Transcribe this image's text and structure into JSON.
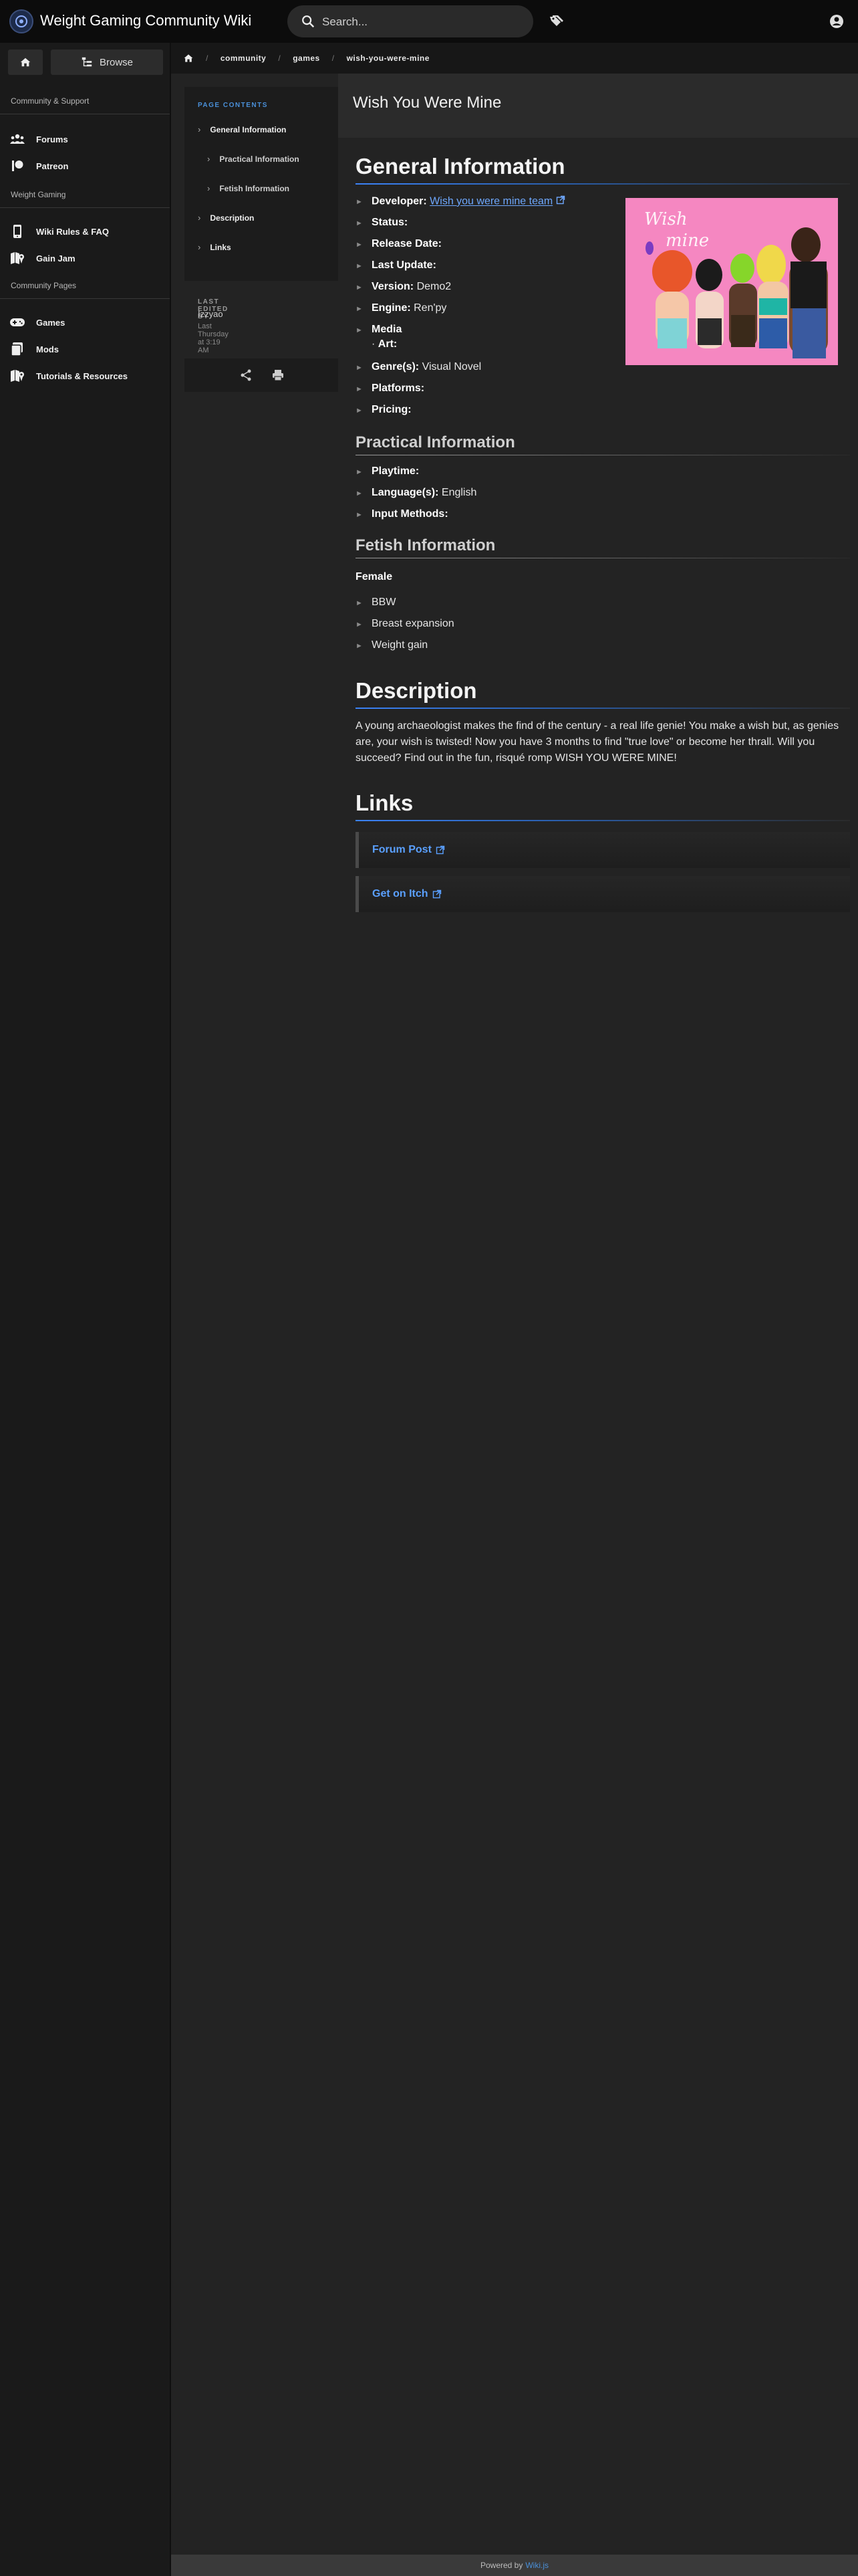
{
  "header": {
    "site_title": "Weight Gaming Community Wiki",
    "search_placeholder": "Search..."
  },
  "sidebar": {
    "browse_label": "Browse",
    "sections": [
      {
        "header": "Community & Support"
      },
      {
        "header": "Weight Gaming"
      },
      {
        "header": "Community Pages"
      }
    ],
    "items": [
      {
        "label": "Forums",
        "icon": "people-icon"
      },
      {
        "label": "Patreon",
        "icon": "patreon-icon"
      },
      {
        "label": "Wiki Rules & FAQ",
        "icon": "phone-rules-icon"
      },
      {
        "label": "Gain Jam",
        "icon": "map-icon"
      },
      {
        "label": "Games",
        "icon": "gamepad-icon"
      },
      {
        "label": "Mods",
        "icon": "cards-icon"
      },
      {
        "label": "Tutorials & Resources",
        "icon": "map-icon"
      }
    ]
  },
  "breadcrumb": [
    "community",
    "games",
    "wish-you-were-mine"
  ],
  "toc": {
    "title": "PAGE CONTENTS",
    "items": [
      {
        "label": "General Information"
      },
      {
        "label": "Practical Information"
      },
      {
        "label": "Fetish Information"
      },
      {
        "label": "Description"
      },
      {
        "label": "Links"
      }
    ],
    "last_edited_label": "LAST EDITED BY",
    "author": "Izzyao",
    "date": "Last Thursday at 3:19 AM"
  },
  "page": {
    "title": "Wish You Were Mine",
    "general": {
      "heading": "General Information",
      "developer_label": "Developer:",
      "developer_value": "Wish you were mine team",
      "status_label": "Status:",
      "release_label": "Release Date:",
      "update_label": "Last Update:",
      "version_label": "Version:",
      "version_value": "Demo2",
      "engine_label": "Engine:",
      "engine_value": "Ren'py",
      "media_label": "Media",
      "art_label": "Art:",
      "genre_label": "Genre(s):",
      "genre_value": "Visual Novel",
      "platforms_label": "Platforms:",
      "pricing_label": "Pricing:"
    },
    "practical": {
      "heading": "Practical Information",
      "playtime_label": "Playtime:",
      "language_label": "Language(s):",
      "language_value": "English",
      "input_label": "Input Methods:"
    },
    "fetish": {
      "heading": "Fetish Information",
      "category": "Female",
      "items": [
        "BBW",
        "Breast expansion",
        "Weight gain"
      ]
    },
    "description": {
      "heading": "Description",
      "text": "A young archaeologist makes the find of the century - a real life genie! You make a wish but, as genies are, your wish is twisted! Now you have 3 months to find \"true love\" or become her thrall. Will you succeed? Find out in the fun, risqué romp WISH YOU WERE MINE!"
    },
    "links": {
      "heading": "Links",
      "items": [
        "Forum Post",
        "Get on Itch"
      ]
    }
  },
  "footer": {
    "prefix": "Powered by",
    "link": "Wiki.js"
  },
  "colors": {
    "accent": "#3b82f6",
    "link": "#6ea8ff",
    "background": "#232323"
  }
}
